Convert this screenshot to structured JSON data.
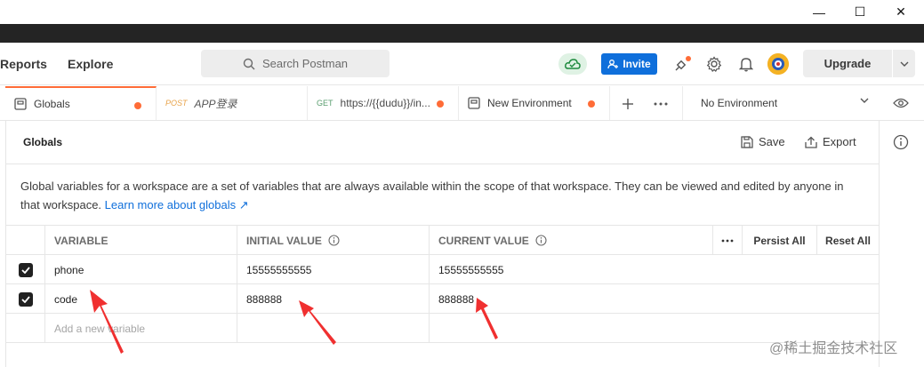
{
  "window_controls": {
    "minimize": "—",
    "maximize": "☐",
    "close": "✕"
  },
  "header": {
    "nav": [
      "Reports",
      "Explore"
    ],
    "search_placeholder": "Search Postman",
    "invite_label": "Invite",
    "upgrade_label": "Upgrade",
    "icons": [
      "cloud-sync-icon",
      "satellite-icon",
      "gear-icon",
      "bell-icon",
      "avatar"
    ]
  },
  "tabs": [
    {
      "label": "Globals",
      "icon": "globe-env-icon",
      "unsaved": true
    },
    {
      "method": "POST",
      "label": "APP登录",
      "unsaved": false
    },
    {
      "method": "GET",
      "label": "https://{{dudu}}/in...",
      "unsaved": true
    },
    {
      "label": "New Environment",
      "icon": "env-icon",
      "unsaved": true
    }
  ],
  "environment_select": {
    "value": "No Environment"
  },
  "content": {
    "title": "Globals",
    "save_label": "Save",
    "export_label": "Export",
    "description": "Global variables for a workspace are a set of variables that are always available within the scope of that workspace. They can be viewed and edited by anyone in that workspace.",
    "learn_more": "Learn more about globals ↗"
  },
  "table": {
    "headers": {
      "variable": "VARIABLE",
      "initial_value": "INITIAL VALUE",
      "current_value": "CURRENT VALUE",
      "persist_all": "Persist All",
      "reset_all": "Reset All"
    },
    "rows": [
      {
        "checked": true,
        "variable": "phone",
        "initial_value": "15555555555",
        "current_value": "15555555555"
      },
      {
        "checked": true,
        "variable": "code",
        "initial_value": "888888",
        "current_value": "888888"
      }
    ],
    "new_placeholder": "Add a new variable"
  },
  "colors": {
    "accent": "#ff6c37",
    "invite_blue": "#0f6fdb",
    "annotation_red": "#f03030"
  },
  "watermark": "@稀土掘金技术社区"
}
